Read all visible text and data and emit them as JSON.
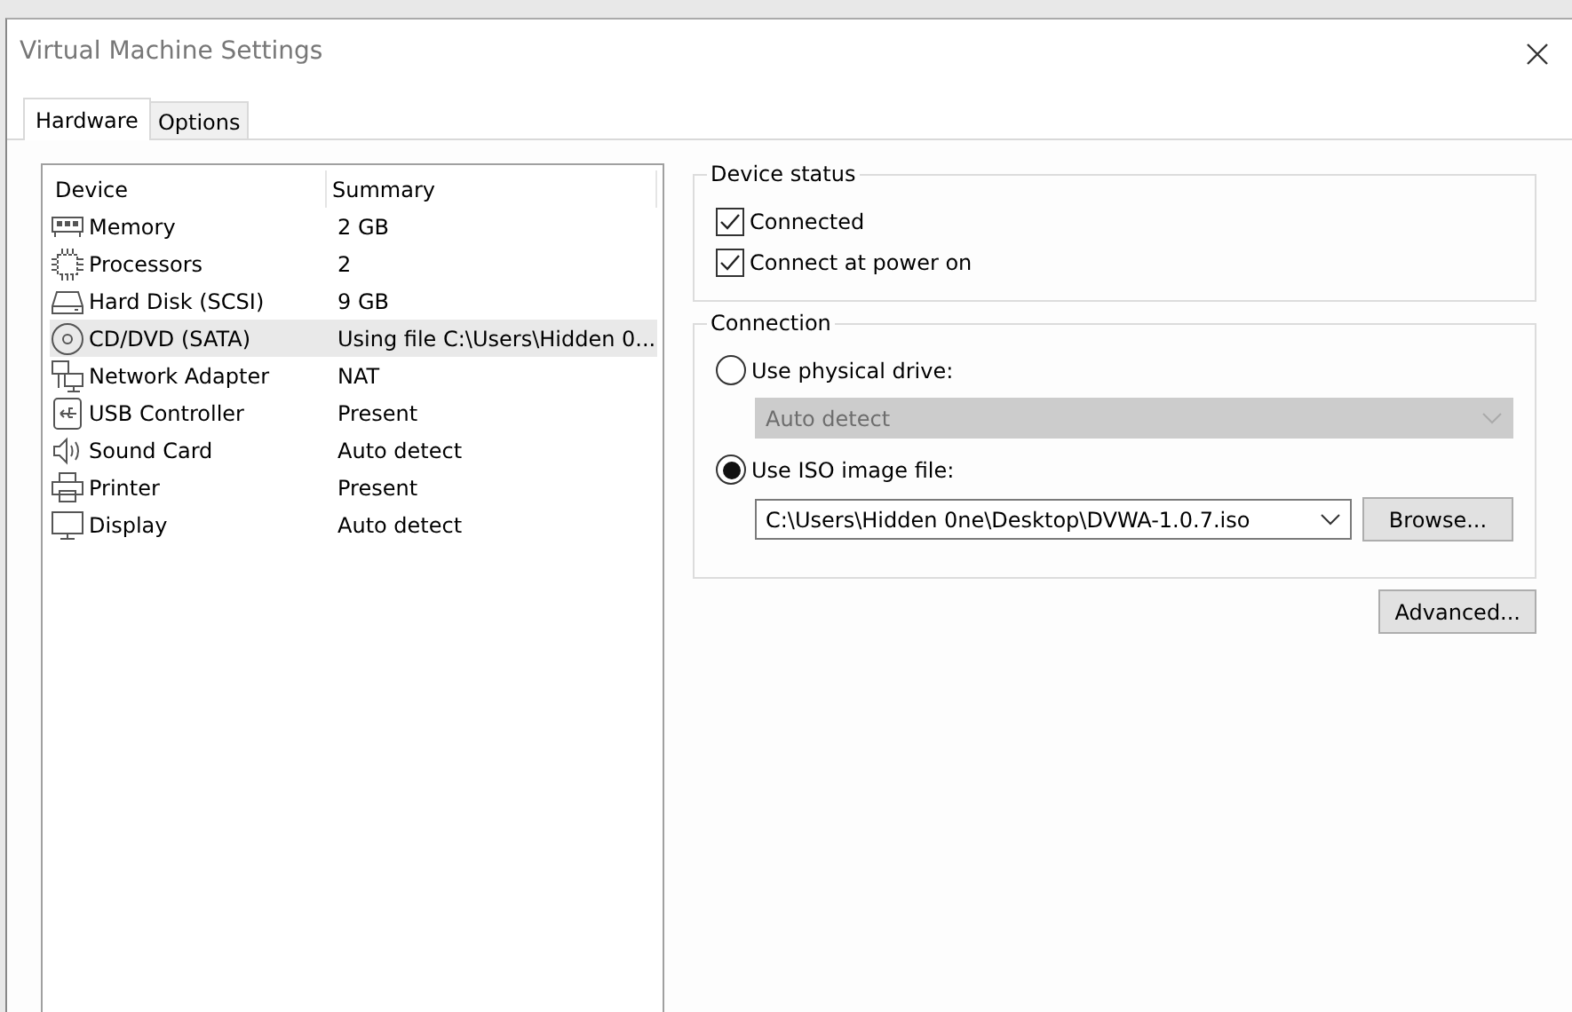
{
  "window": {
    "title": "Virtual Machine Settings"
  },
  "tabs": [
    {
      "label": "Hardware",
      "selected": true
    },
    {
      "label": "Options",
      "selected": false
    }
  ],
  "device_list": {
    "columns": [
      "Device",
      "Summary"
    ],
    "rows": [
      {
        "kind": "memory",
        "device": "Memory",
        "summary": "2 GB",
        "selected": false
      },
      {
        "kind": "processor",
        "device": "Processors",
        "summary": "2",
        "selected": false
      },
      {
        "kind": "disk",
        "device": "Hard Disk (SCSI)",
        "summary": "9 GB",
        "selected": false
      },
      {
        "kind": "cd",
        "device": "CD/DVD (SATA)",
        "summary": "Using file C:\\Users\\Hidden 0...",
        "selected": true
      },
      {
        "kind": "network",
        "device": "Network Adapter",
        "summary": "NAT",
        "selected": false
      },
      {
        "kind": "usb",
        "device": "USB Controller",
        "summary": "Present",
        "selected": false
      },
      {
        "kind": "sound",
        "device": "Sound Card",
        "summary": "Auto detect",
        "selected": false
      },
      {
        "kind": "printer",
        "device": "Printer",
        "summary": "Present",
        "selected": false
      },
      {
        "kind": "display",
        "device": "Display",
        "summary": "Auto detect",
        "selected": false
      }
    ]
  },
  "device_status": {
    "title": "Device status",
    "options": [
      {
        "label": "Connected",
        "checked": true
      },
      {
        "label": "Connect at power on",
        "checked": true
      }
    ]
  },
  "connection": {
    "title": "Connection",
    "physical_drive": {
      "label": "Use physical drive:",
      "selected": false,
      "value": "Auto detect",
      "disabled": true
    },
    "iso_file": {
      "label": "Use ISO image file:",
      "selected": true,
      "value": "C:\\Users\\Hidden 0ne\\Desktop\\DVWA-1.0.7.iso",
      "button": "Browse..."
    }
  },
  "advanced_button": "Advanced..."
}
